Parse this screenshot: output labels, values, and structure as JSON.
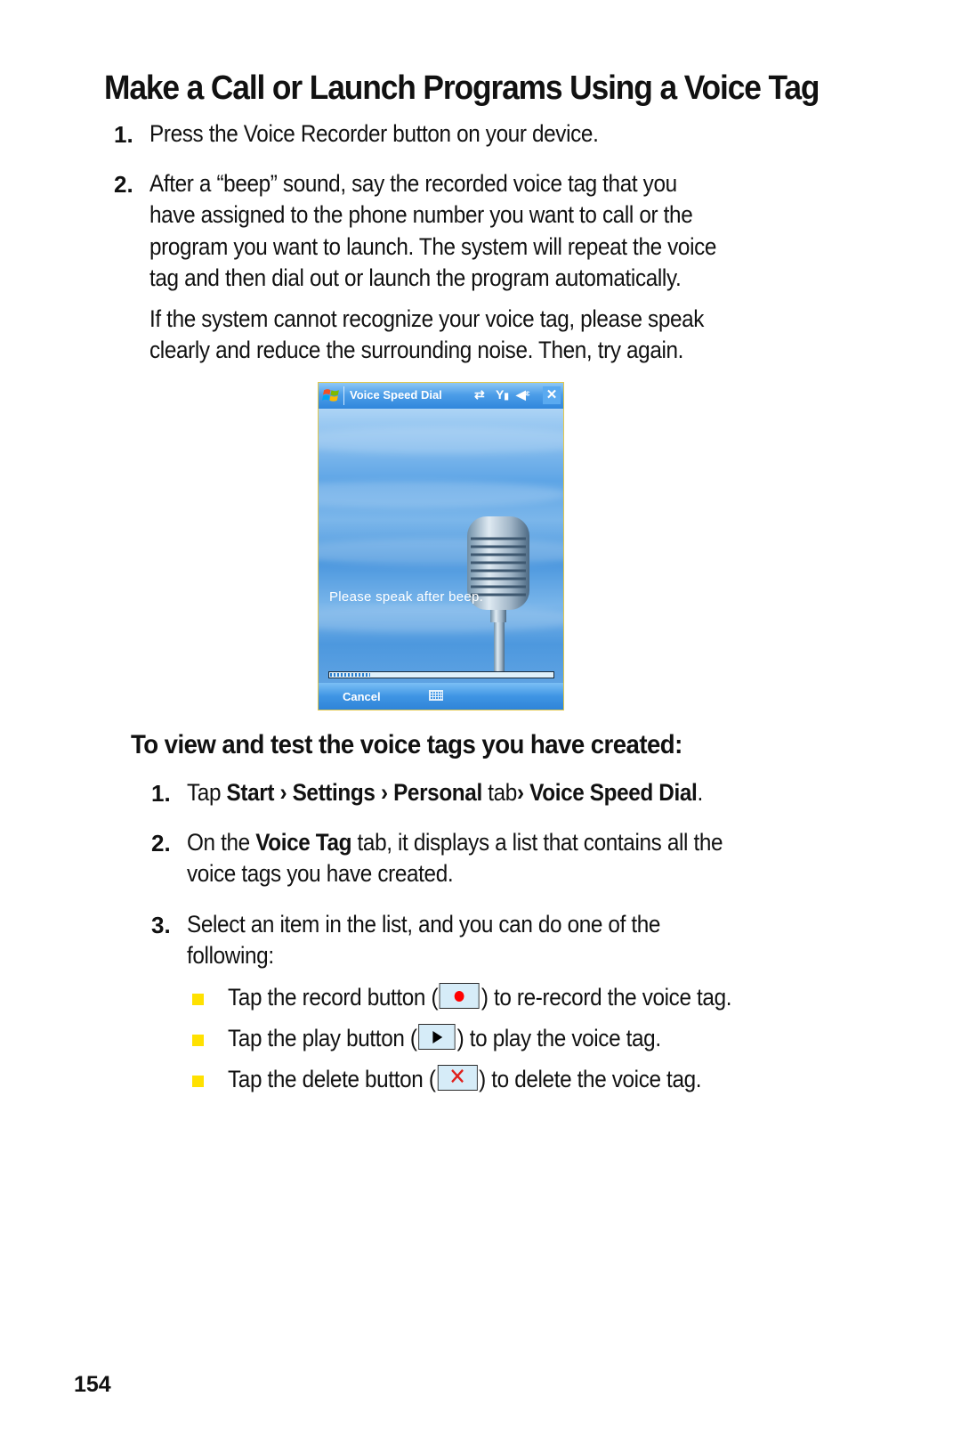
{
  "page": {
    "title": "Make a Call or Launch Programs Using a Voice Tag",
    "page_number": "154"
  },
  "section1": {
    "steps": [
      {
        "num": "1.",
        "lines": [
          "Press the Voice Recorder button on your device."
        ]
      },
      {
        "num": "2.",
        "lines": [
          "After a “beep” sound, say the recorded voice tag that you",
          "have assigned to the phone number you want to call or the",
          "program you want to launch. The system will repeat the voice",
          "tag and then dial out or launch the program automatically."
        ]
      }
    ],
    "note_lines": [
      "If the system cannot recognize your voice tag, please speak",
      "clearly and reduce the surrounding noise. Then, try again."
    ]
  },
  "device_screen": {
    "window_title": "Voice Speed Dial",
    "status_icons": [
      "connectivity-icon",
      "signal-icon",
      "volume-icon"
    ],
    "close_label": "✕",
    "prompt": "Please speak after beep.",
    "progress_percent": 18,
    "menu_left": "Cancel",
    "menu_center_icon": "keyboard-icon",
    "colors": {
      "titlebar": "#3a8fe0",
      "frame": "#e4c84a"
    }
  },
  "section2": {
    "heading": "To view and test the voice tags you have created:",
    "step1": {
      "num": "1.",
      "tap": "Tap ",
      "start": "Start",
      "sep": " › ",
      "settings": "Settings",
      "personal": "Personal",
      "tab": " tab ",
      "voice_speed_dial": "Voice Speed Dial",
      "end": "."
    },
    "step2": {
      "num": "2.",
      "pre": "On the ",
      "bold": "Voice Tag",
      "post": " tab, it displays a list that contains all the",
      "line2": "voice tags you have created."
    },
    "step3": {
      "num": "3.",
      "line1": "Select an item in the list, and you can do one of the",
      "line2": "following:"
    },
    "bullets": [
      {
        "pre": "Tap the record button (",
        "icon": "record-icon",
        "post": ") to re-record the voice tag."
      },
      {
        "pre": "Tap the play button (",
        "icon": "play-icon",
        "post": ") to play the voice tag."
      },
      {
        "pre": "Tap the delete button (",
        "icon": "delete-icon",
        "post": ") to delete the voice tag."
      }
    ],
    "bullet_color": "#ffe100",
    "delete_glyph": "✕"
  }
}
